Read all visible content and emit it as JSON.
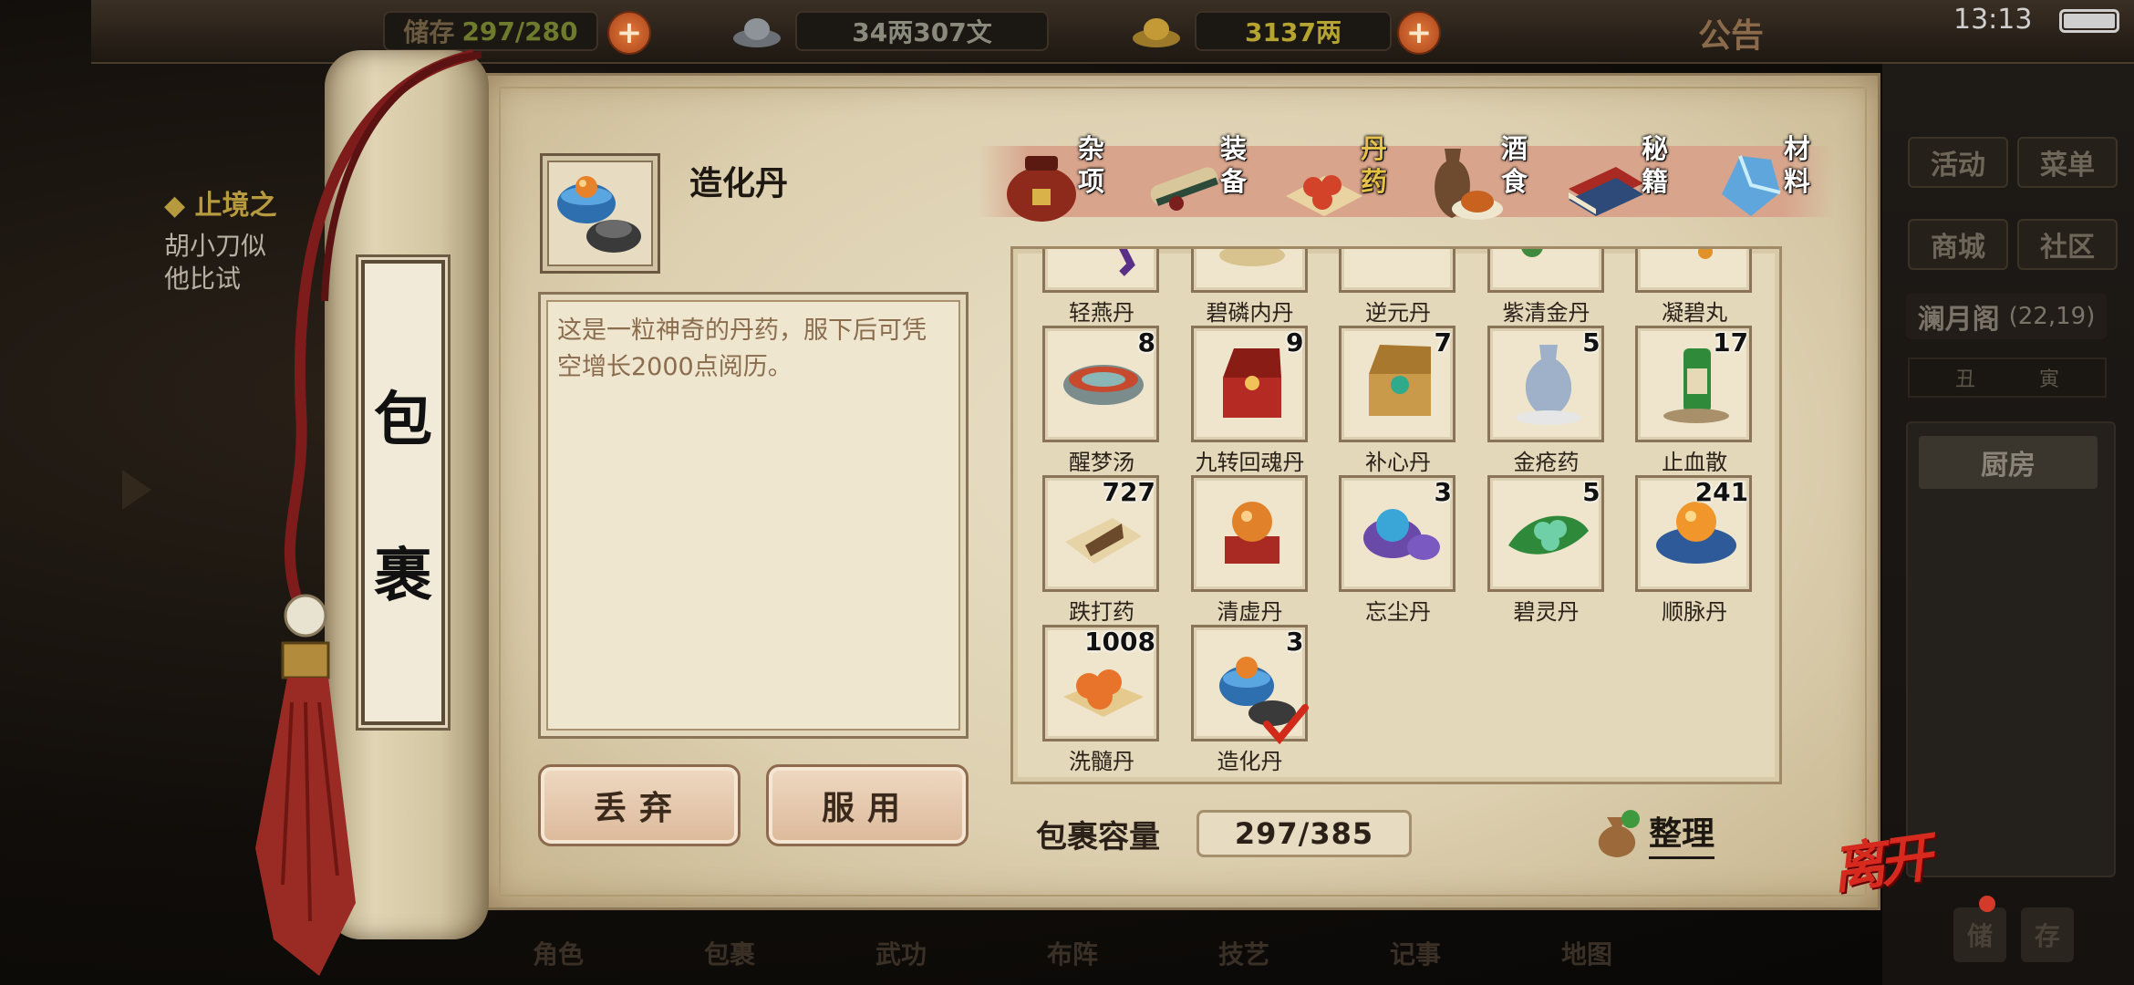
{
  "topbar": {
    "storage_label": "储存",
    "storage_value": "297/280",
    "silver": "34两307文",
    "gold": "3137两",
    "notice": "公告",
    "clock": "13:13"
  },
  "quest": {
    "title": "◆ 止境之",
    "line1": "胡小刀似",
    "line2": "他比试"
  },
  "right_panel": {
    "activity": "活动",
    "menu": "菜单",
    "shop": "商城",
    "community": "社区",
    "location": "澜月阁",
    "coords": "(22,19)",
    "time_left": "丑",
    "time_right": "寅",
    "kitchen": "厨房",
    "btn_a": "储",
    "btn_b": "存"
  },
  "bottom_nav": [
    "角色",
    "包裹",
    "武功",
    "布阵",
    "技艺",
    "记事",
    "地图"
  ],
  "bag": {
    "scroll_title_1": "包",
    "scroll_title_2": "裹",
    "selected_name": "造化丹",
    "description": "这是一粒神奇的丹药，服下后可凭空增长2000点阅历。",
    "discard_label": "丢弃",
    "use_label": "服用",
    "capacity_label": "包裹容量",
    "capacity_value": "297/385",
    "sort_label": "整理",
    "leave_label": "离开"
  },
  "tabs": [
    {
      "label": "杂项",
      "icon": "jar-icon"
    },
    {
      "label": "装备",
      "icon": "scroll-weapon-icon"
    },
    {
      "label": "丹药",
      "icon": "pills-icon",
      "active": true
    },
    {
      "label": "酒食",
      "icon": "wine-food-icon"
    },
    {
      "label": "秘籍",
      "icon": "books-icon"
    },
    {
      "label": "材料",
      "icon": "crystal-icon"
    }
  ],
  "items": [
    {
      "name": "轻燕丹",
      "count": "",
      "icon": "purple-cloth-icon"
    },
    {
      "name": "碧磷内丹",
      "count": "",
      "icon": "red-pill-icon"
    },
    {
      "name": "逆元丹",
      "count": "",
      "icon": "gold-box-icon"
    },
    {
      "name": "紫清金丹",
      "count": "",
      "icon": "purple-pill-icon"
    },
    {
      "name": "凝碧丸",
      "count": "",
      "icon": "blue-pouch-icon"
    },
    {
      "name": "醒梦汤",
      "count": "8",
      "icon": "soup-bowl-icon"
    },
    {
      "name": "九转回魂丹",
      "count": "9",
      "icon": "red-chest-icon"
    },
    {
      "name": "补心丹",
      "count": "7",
      "icon": "wood-box-icon"
    },
    {
      "name": "金疮药",
      "count": "5",
      "icon": "vase-icon"
    },
    {
      "name": "止血散",
      "count": "17",
      "icon": "bottle-icon"
    },
    {
      "name": "跌打药",
      "count": "727",
      "icon": "paper-pack-icon"
    },
    {
      "name": "清虚丹",
      "count": "",
      "icon": "orange-pill-stand-icon"
    },
    {
      "name": "忘尘丹",
      "count": "3",
      "icon": "blue-pill-jar-icon"
    },
    {
      "name": "碧灵丹",
      "count": "5",
      "icon": "leaf-pills-icon"
    },
    {
      "name": "顺脉丹",
      "count": "241",
      "icon": "orange-pill-tray-icon"
    },
    {
      "name": "洗髓丹",
      "count": "1008",
      "icon": "orange-pills-plate-icon"
    },
    {
      "name": "造化丹",
      "count": "3",
      "icon": "blue-jar-pill-icon",
      "selected": true
    }
  ],
  "colors": {
    "paper": "#e4d8bb",
    "active_tab": "#e6c14a",
    "gold_text": "#b5a431",
    "leave_red": "#d62a1e"
  }
}
